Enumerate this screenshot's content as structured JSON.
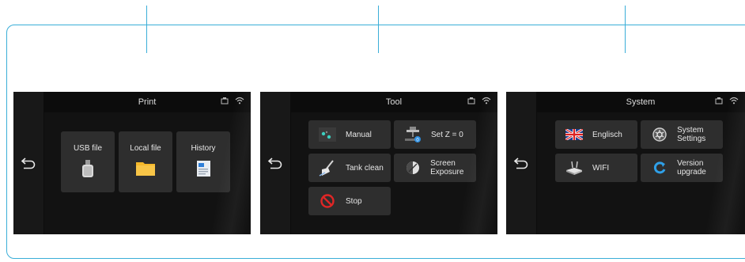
{
  "screens": [
    {
      "title": "Print",
      "items": [
        {
          "label": "USB file",
          "icon": "usb-drive-icon"
        },
        {
          "label": "Local file",
          "icon": "folder-icon"
        },
        {
          "label": "History",
          "icon": "document-icon"
        }
      ]
    },
    {
      "title": "Tool",
      "items": [
        {
          "label": "Manual",
          "icon": "manual-move-icon"
        },
        {
          "label": "Set Z = 0",
          "icon": "z-zero-icon"
        },
        {
          "label": "Tank clean",
          "icon": "broom-icon"
        },
        {
          "label": "Screen Exposure",
          "icon": "exposure-icon"
        },
        {
          "label": "Stop",
          "icon": "stop-icon"
        }
      ]
    },
    {
      "title": "System",
      "items": [
        {
          "label": "Englisch",
          "icon": "uk-flag-icon"
        },
        {
          "label": "System Settings",
          "icon": "settings-gear-icon"
        },
        {
          "label": "WIFI",
          "icon": "router-icon"
        },
        {
          "label": "Version upgrade",
          "icon": "upgrade-refresh-icon"
        }
      ]
    }
  ],
  "colors": {
    "accent": "#3aaed8",
    "screen_bg": "#121212",
    "tile_bg": "#2e2e2e",
    "stop_red": "#e02626",
    "folder_yellow": "#f5b82a"
  }
}
